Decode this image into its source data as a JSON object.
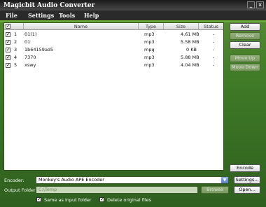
{
  "window": {
    "title": "Magicbit Audio Converter",
    "controls": {
      "minimize": "_",
      "close": "×"
    }
  },
  "menu": {
    "file": "File",
    "settings": "Settings",
    "tools": "Tools",
    "help": "Help"
  },
  "table": {
    "header": {
      "name": "Name",
      "type": "Type",
      "size": "Size",
      "status": "Status"
    },
    "rows": [
      {
        "num": "1",
        "name": "01(1)",
        "type": "mp3",
        "size": "4.61 MB",
        "status": "-"
      },
      {
        "num": "2",
        "name": "01",
        "type": "mp3",
        "size": "5.58 MB",
        "status": "-"
      },
      {
        "num": "3",
        "name": "1b64159ad5",
        "type": "mpg",
        "size": "0 KB",
        "status": "-"
      },
      {
        "num": "4",
        "name": "7370",
        "type": "mp3",
        "size": "5.88 MB",
        "status": "-"
      },
      {
        "num": "5",
        "name": "xswy",
        "type": "mp3",
        "size": "4.04 MB",
        "status": "-"
      }
    ]
  },
  "sidebar": {
    "add": "Add",
    "remove": "Remove",
    "clear": "Clear",
    "move_up": "Move Up",
    "move_down": "Move Down",
    "encode": "Encode"
  },
  "encoder": {
    "label": "Encoder:",
    "value": "Monkey's Audio APE Encoder",
    "settings_button": "Settings..."
  },
  "output": {
    "label": "Output Folder:",
    "value": "C:\\Temp",
    "browse_button": "Browse",
    "open_button": "Open..."
  },
  "options": {
    "same_as_input": "Same as input folder",
    "delete_original": "Delete original files"
  }
}
